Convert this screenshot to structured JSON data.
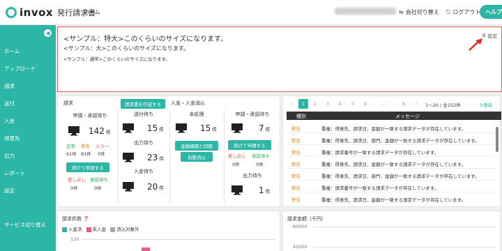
{
  "header": {
    "logo": "invox",
    "app_name": "発行請求書",
    "home": "ホーム",
    "account": "",
    "switch": "会社切り替え",
    "logout": "ログアウト",
    "help": "ヘルプ"
  },
  "sidebar": {
    "items": [
      "ホーム",
      "アップロード",
      "請求",
      "送付",
      "入金",
      "得意先",
      "出力",
      "レポート",
      "設定",
      "サービス切り替え"
    ]
  },
  "notice": {
    "large": "<サンプル：特大>このくらいのサイズになります。",
    "medium": "<サンプル：大>このくらいのサイズになります。",
    "small": "<サンプル：通常>このくらいのサイズになります。",
    "settings": "設定"
  },
  "summary": {
    "invoice": {
      "title": "請求",
      "create_button": "請求書を作成する",
      "pending_label": "申請・承認待ち",
      "pending_count": "142",
      "unit": "件",
      "status_normal": "正常",
      "status_warning": "警告",
      "status_error": "エラー",
      "normal_count": "61件",
      "warning_count": "81件",
      "error_count": "0件",
      "continue_button": "続けて申請する",
      "returned": "差し戻し",
      "approval_wait": "承認待ち",
      "returned_count": "0件",
      "approval_count": "0件"
    },
    "send": {
      "waiting_label": "送付待ち",
      "waiting_count": "15",
      "output_label": "出力待ち",
      "output_count": "23",
      "deposit_label": "入金待ち",
      "deposit_count": "20",
      "unit": "件"
    },
    "payment": {
      "title": "入金・入金消込",
      "unprocessed": "未処理",
      "unprocessed_count": "15",
      "unit": "件",
      "bank_button": "金融機関と同期",
      "auto_button": "自動消込",
      "pending_label": "申請・承認待ち",
      "pending_count": "7",
      "continue_button": "続けて申請する",
      "returned": "差し戻し",
      "approval_wait": "承認待ち",
      "returned_count": "0件",
      "approval_count": "0件",
      "output_label": "出力待ち",
      "output_count": "1"
    }
  },
  "messages": {
    "pages": [
      "1",
      "2",
      "3",
      "4",
      "5",
      "6",
      "...",
      "8"
    ],
    "range": "1〜20 / 全152件",
    "refresh": "更新",
    "col_type": "種別",
    "col_message": "メッセージ",
    "rows": [
      {
        "level": "警告",
        "text": "重複：得意先、請求日、金額が一致する請求データが存在しています。"
      },
      {
        "level": "警告",
        "text": "重複：得意先、請求日、部門、金額が一致する請求データが存在しています。"
      },
      {
        "level": "警告",
        "text": "重複：請求番号が一致する請求データが存在しています。"
      },
      {
        "level": "警告",
        "text": "重複：得意先、請求日、金額が一致する請求データが存在しています。"
      },
      {
        "level": "警告",
        "text": "重複：得意先、請求日、部門、金額が一致する請求データが存在しています。"
      },
      {
        "level": "警告",
        "text": "重複：請求番号が一致する請求データが存在しています。"
      },
      {
        "level": "警告",
        "text": "重複：得意先、請求日、金額が一致する請求データが存在しています。"
      }
    ]
  },
  "chart_left": {
    "title": "請求件数",
    "legend": [
      "入金済",
      "未入金",
      "消込対象外"
    ],
    "legend_colors": [
      "#2bb6a5",
      "#e8588a",
      "#aaaaaa"
    ],
    "y_tick": "120"
  },
  "chart_right": {
    "title": "請求金額（千円）",
    "y_ticks": [
      "60000",
      "45000"
    ]
  },
  "colors": {
    "accent": "#2bb6a5",
    "error": "#e85a5a",
    "warning": "#e88a1a"
  }
}
